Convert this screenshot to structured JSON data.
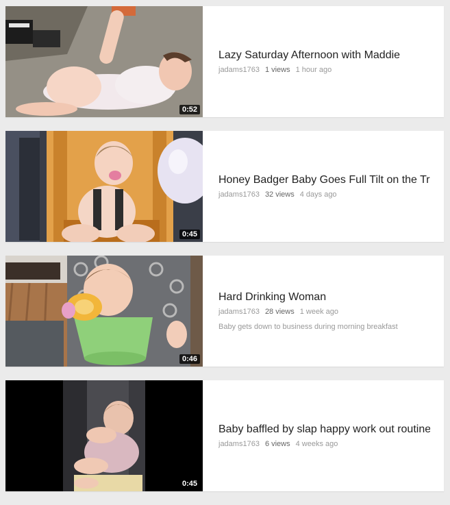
{
  "videos": [
    {
      "title": "Lazy Saturday Afternoon with Maddie",
      "author": "jadams1763",
      "views": "1 views",
      "age": "1 hour ago",
      "duration": "0:52",
      "description": ""
    },
    {
      "title": "Honey Badger Baby Goes Full Tilt on the Tr",
      "author": "jadams1763",
      "views": "32 views",
      "age": "4 days ago",
      "duration": "0:45",
      "description": ""
    },
    {
      "title": "Hard Drinking Woman",
      "author": "jadams1763",
      "views": "28 views",
      "age": "1 week ago",
      "duration": "0:46",
      "description": "Baby gets down to business during morning breakfast"
    },
    {
      "title": "Baby baffled by slap happy work out routine",
      "author": "jadams1763",
      "views": "6 views",
      "age": "4 weeks ago",
      "duration": "0:45",
      "description": ""
    }
  ]
}
